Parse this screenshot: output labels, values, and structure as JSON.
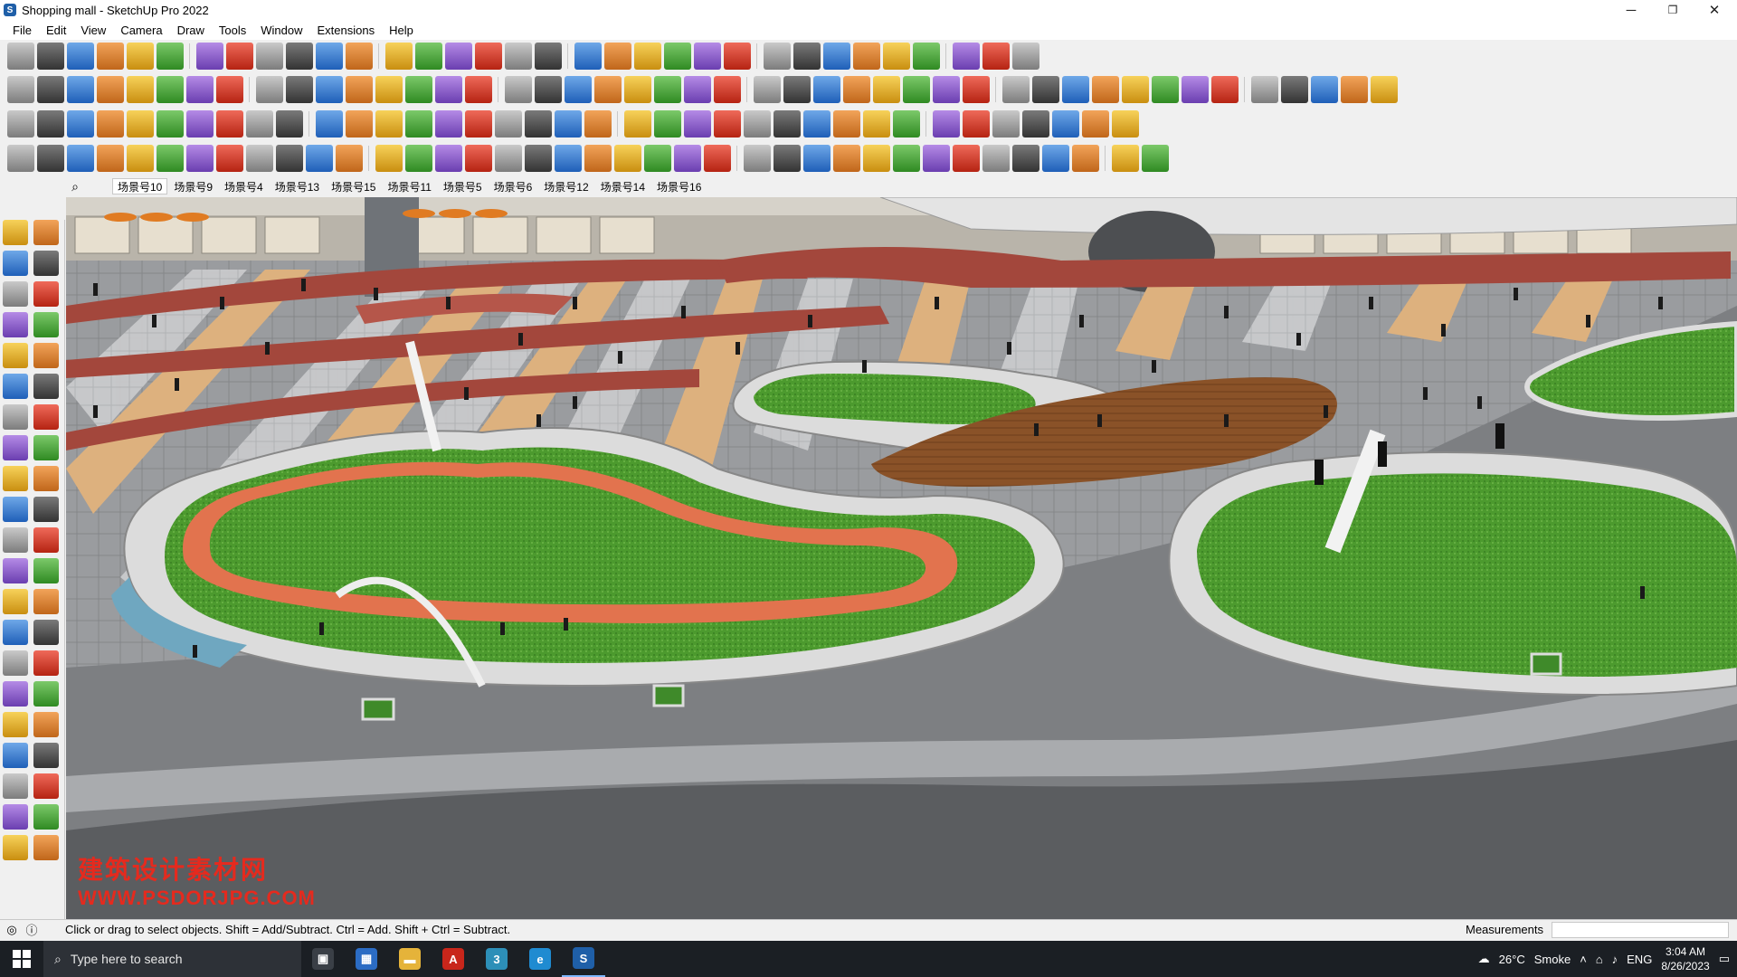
{
  "window": {
    "title": "Shopping mall - SketchUp Pro 2022",
    "minimize_glyph": "─",
    "maximize_glyph": "❐",
    "close_glyph": "✕"
  },
  "menu": [
    "File",
    "Edit",
    "View",
    "Camera",
    "Draw",
    "Tools",
    "Window",
    "Extensions",
    "Help"
  ],
  "toolbars": {
    "row1": [
      "zoom-icon",
      "select-icon",
      "eraser-icon",
      "pencil-icon",
      "lasso-icon",
      "paint-icon",
      "push-pull-icon",
      "follow-me-icon",
      "move-icon",
      "rotate-icon",
      "scale-icon",
      "tape-icon",
      "text-icon",
      "paint-bucket-icon",
      "orbit-icon",
      "pan-icon",
      "zoom-window-icon",
      "zoom-extents-icon",
      "section-icon",
      "layers-icon",
      "styles-icon",
      "xray-icon",
      "user-icon",
      "component-icon",
      "group-icon",
      "flip-icon",
      "arrows-up-icon",
      "arrows-down-icon",
      "axes-icon",
      "match-photo-icon",
      "undo-icon",
      "redo-icon",
      "extension-icon"
    ],
    "row2": [
      "cube-yellow-icon",
      "cube-white-icon",
      "cube-wire-icon",
      "push-red-icon",
      "push-blue-icon",
      "push-down-icon",
      "push-orange-icon",
      "push-green-icon",
      "push-gold-icon",
      "push-up-icon",
      "push-magenta-icon",
      "curve-icon",
      "plane-blue-icon",
      "plane-purple-icon",
      "plane-violet-icon",
      "terrain-green-icon",
      "terrain-fold-icon",
      "house-1-icon",
      "house-2-icon",
      "house-3-icon",
      "house-4-icon",
      "house-5-icon",
      "house-6-icon",
      "f6-icon",
      "tag-icon",
      "brush-icon",
      "rect-icon",
      "circle-icon",
      "hexagon-icon",
      "ellipse-icon",
      "parallelogram-icon",
      "arc-icon",
      "circle-2-icon",
      "gear-path-icon",
      "spline-icon",
      "spiral-icon",
      "line-red-icon",
      "eraser-pink-icon",
      "box-brown-icon",
      "box-red-icon",
      "box-grey-icon",
      "box-dark-icon",
      "hand-icon",
      "stamp-icon",
      "flag-icon"
    ],
    "row3": [
      "plane-blue-2-icon",
      "plane-blue-3-icon",
      "plane-yellow-icon",
      "ruby-icon",
      "plane-white-icon",
      "arc-orange-icon",
      "square-red-icon",
      "stack-icon",
      "bend-icon",
      "wood-icon",
      "chain-icon",
      "curve-red-icon",
      "line-dots-icon",
      "plus-red-icon",
      "plus-green-icon",
      "x-blue-icon",
      "fountain-icon",
      "cone-icon",
      "warning-icon",
      "loop-icon",
      "cross-loop-icon",
      "refresh-icon",
      "compass-icon",
      "barrel-icon",
      "link-icon",
      "ladder-icon",
      "cubes-icon",
      "cubes-2-icon",
      "block-red-icon",
      "pattern-icon",
      "grid-icon",
      "hatch-icon",
      "tile-icon",
      "tile-2-icon",
      "x-small-icon",
      "dot-arc-icon",
      "grid-dots-icon"
    ],
    "row4": [
      "node-icon",
      "spline-red-icon",
      "ruler-icon",
      "vertex-icon",
      "shape-icon",
      "cylinder-icon",
      "cross-section-icon",
      "sphere-icon",
      "bend-2-icon",
      "wave-icon",
      "bracket-icon",
      "line-red-2-icon",
      "curve-red-2-icon",
      "stairs-icon",
      "shell-icon",
      "pipe-icon",
      "column-icon",
      "columns-icon",
      "ring-icon",
      "roof-icon",
      "shingle-icon",
      "fence-icon",
      "wall-icon",
      "slab-icon",
      "wedge-icon",
      "arch-icon",
      "arch-2-icon",
      "panel-icon",
      "panel-2-icon",
      "texture-icon",
      "texture-2-icon",
      "grille-icon",
      "gate-icon",
      "dome-icon",
      "dome-2-icon",
      "slope-icon",
      "rack-icon",
      "shield-icon"
    ]
  },
  "scene_search_glyph": "⌕",
  "scene_tabs": [
    "场景号10",
    "场景号9",
    "场景号4",
    "场景号13",
    "场景号15",
    "场景号11",
    "场景号5",
    "场景号6",
    "场景号12",
    "场景号14",
    "场景号16"
  ],
  "active_scene": "场景号10",
  "left_tools": [
    "select-icon",
    "orbit-icon",
    "paint-icon",
    "eraser-icon",
    "component-icon",
    "tape-icon",
    "line-icon",
    "freehand-icon",
    "rect-icon",
    "rotated-rect-icon",
    "circle-icon",
    "polygon-icon",
    "arc-icon",
    "pie-icon",
    "arc-2-icon",
    "arc-3-icon",
    "move-icon",
    "push-pull-icon",
    "rotate-icon",
    "follow-me-icon",
    "scale-icon",
    "offset-icon",
    "tape-2-icon",
    "dimension-icon",
    "protractor-icon",
    "text-icon",
    "axes-icon",
    "3d-text-icon",
    "orbit-2-icon",
    "pan-icon",
    "zoom-icon",
    "zoom-window-icon",
    "zoom-extents-icon",
    "previous-icon",
    "position-camera-icon",
    "look-around-icon",
    "walk-icon",
    "section-plane-icon",
    "section-2-icon",
    "section-3-icon",
    "section-4-icon",
    "section-5-icon"
  ],
  "watermark": {
    "line1": "建筑设计素材网",
    "line2": "WWW.PSDORJPG.COM"
  },
  "status": {
    "message": "Click or drag to select objects. Shift = Add/Subtract. Ctrl = Add. Shift + Ctrl = Subtract.",
    "measurements_label": "Measurements",
    "measurements_value": ""
  },
  "taskbar": {
    "search_placeholder": "Type here to search",
    "apps": [
      "task-view-icon",
      "calculator-icon",
      "file-explorer-icon",
      "acrobat-icon",
      "app-3-icon",
      "edge-icon",
      "sketchup-icon"
    ],
    "weather_temp": "26°C",
    "weather_desc": "Smoke",
    "language": "ENG",
    "time": "3:04 AM",
    "date": "8/26/2023"
  }
}
